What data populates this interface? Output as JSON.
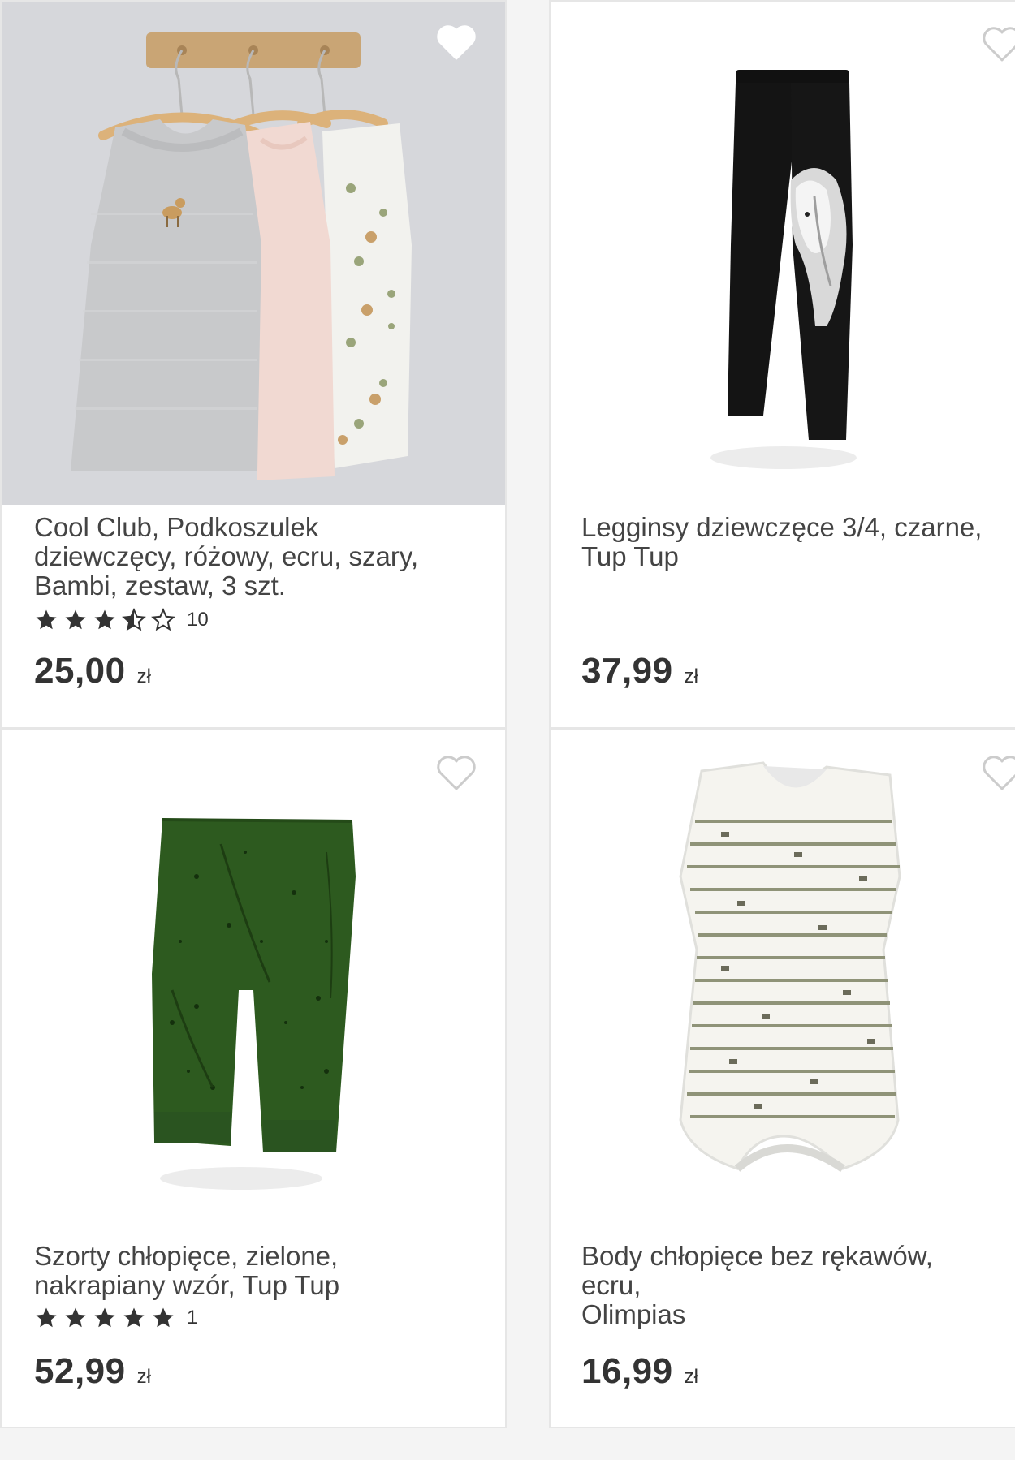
{
  "products": [
    {
      "title": "Cool Club, Podkoszulek\ndziewczęcy, różowy, ecru, szary,\nBambi, zestaw, 3 szt.",
      "rating": 3.5,
      "rating_max": 5,
      "rating_count": "10",
      "price": "25,00",
      "currency": "zł",
      "wishlisted": true,
      "image_icon": "tank-top-set-photo"
    },
    {
      "title": "Legginsy dziewczęce 3/4, czarne,\nTup Tup",
      "price": "37,99",
      "currency": "zł",
      "wishlisted": false,
      "image_icon": "black-leggings-photo"
    },
    {
      "title": "Szorty chłopięce, zielone,\nnakrapiany wzór, Tup Tup",
      "rating": 5,
      "rating_max": 5,
      "rating_count": "1",
      "price": "52,99",
      "currency": "zł",
      "wishlisted": false,
      "image_icon": "green-shorts-photo"
    },
    {
      "title": "Body chłopięce bez rękawów, ecru,\nOlimpias",
      "price": "16,99",
      "currency": "zł",
      "wishlisted": false,
      "image_icon": "striped-bodysuit-photo"
    }
  ],
  "colors": {
    "text": "#444444",
    "price": "#333333",
    "star": "#333333",
    "heart_outline": "#cccccc",
    "heart_filled": "#ffffff",
    "card_border": "#e6e6e6"
  }
}
